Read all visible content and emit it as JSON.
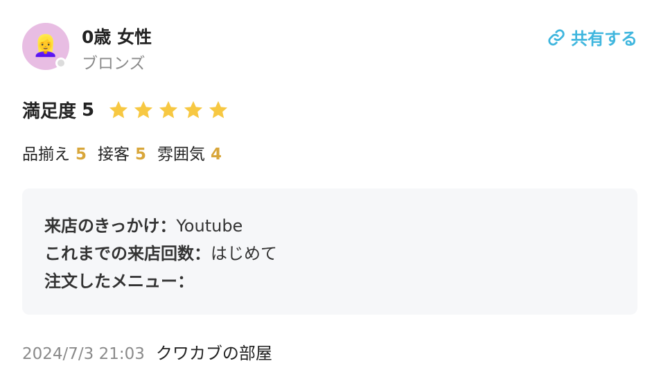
{
  "reviewer": {
    "avatar_emoji": "👱‍♀️",
    "name": "0歳 女性",
    "rank": "ブロンズ"
  },
  "share": {
    "label": "共有する",
    "icon": "link-icon",
    "color": "#3fb6de"
  },
  "satisfaction": {
    "label": "満足度",
    "score": "5",
    "stars_filled": 5,
    "stars_total": 5,
    "star_color": "#f7c842"
  },
  "subratings": [
    {
      "label": "品揃え",
      "score": "5"
    },
    {
      "label": "接客",
      "score": "5"
    },
    {
      "label": "雰囲気",
      "score": "4"
    }
  ],
  "details": [
    {
      "key": "来店のきっかけ：",
      "value": "Youtube"
    },
    {
      "key": "これまでの来店回数：",
      "value": "はじめて"
    },
    {
      "key": "注文したメニュー：",
      "value": ""
    }
  ],
  "footer": {
    "date": "2024/7/3 21:03",
    "shop": "クワカブの部屋"
  }
}
